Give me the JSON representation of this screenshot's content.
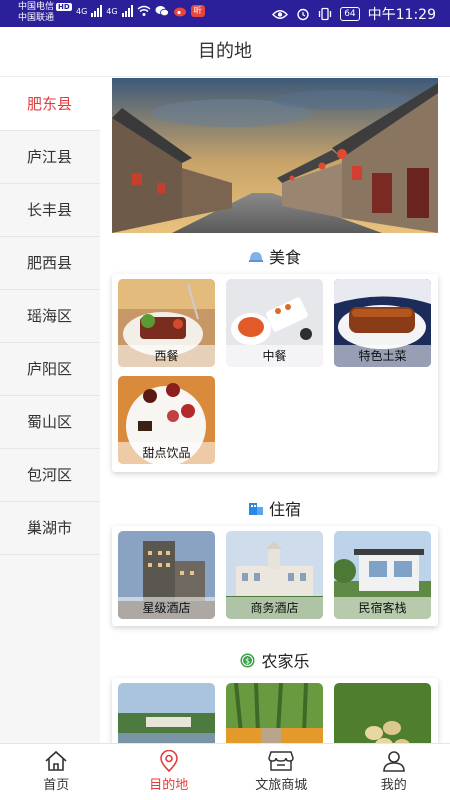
{
  "status_bar": {
    "carrier1": "中国电信",
    "carrier1_badge": "HD",
    "carrier2": "中国联通",
    "net1": "4G",
    "net2": "4G",
    "app_badge": "听",
    "battery": "64",
    "time": "中午11:29"
  },
  "header": {
    "title": "目的地"
  },
  "sidebar": {
    "items": [
      {
        "label": "肥东县"
      },
      {
        "label": "庐江县"
      },
      {
        "label": "长丰县"
      },
      {
        "label": "肥西县"
      },
      {
        "label": "瑶海区"
      },
      {
        "label": "庐阳区"
      },
      {
        "label": "蜀山区"
      },
      {
        "label": "包河区"
      },
      {
        "label": "巢湖市"
      }
    ]
  },
  "sections": {
    "food": {
      "title": "美食",
      "tiles": [
        {
          "label": "西餐"
        },
        {
          "label": "中餐"
        },
        {
          "label": "特色土菜"
        },
        {
          "label": "甜点饮品"
        }
      ]
    },
    "lodging": {
      "title": "住宿",
      "tiles": [
        {
          "label": "星级酒店"
        },
        {
          "label": "商务酒店"
        },
        {
          "label": "民宿客栈"
        }
      ]
    },
    "farm": {
      "title": "农家乐",
      "tiles": [
        {},
        {},
        {}
      ]
    }
  },
  "bottom_nav": {
    "items": [
      {
        "label": "首页",
        "icon": "home-icon"
      },
      {
        "label": "目的地",
        "icon": "location-pin-icon"
      },
      {
        "label": "文旅商城",
        "icon": "shop-icon"
      },
      {
        "label": "我的",
        "icon": "user-icon"
      }
    ]
  },
  "colors": {
    "accent": "#e33c3c",
    "status_bar": "#2b1f9a",
    "food_icon": "#7fb2ea",
    "lodging_icon": "#2a88e0",
    "farm_icon": "#3aa047"
  }
}
